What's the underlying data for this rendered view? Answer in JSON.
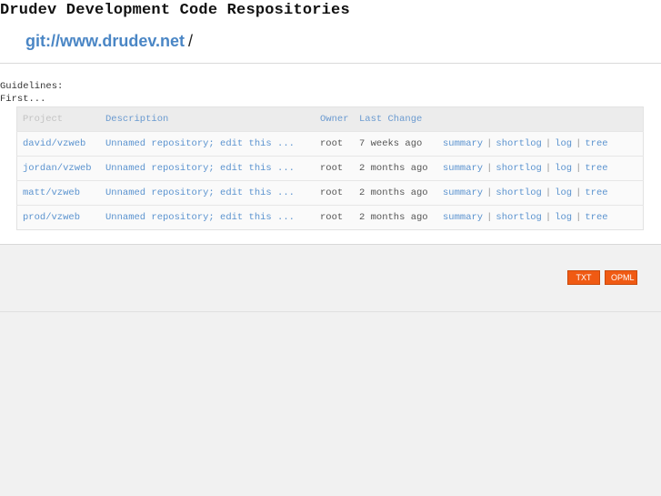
{
  "site": {
    "title": "Drudev Development Code Respositories",
    "url_link": "git://www.drudev.net",
    "url_suffix": "/"
  },
  "intro": {
    "guidelines_label": "Guidelines:",
    "first_line": "First..."
  },
  "table": {
    "headers": {
      "project": "Project",
      "description": "Description",
      "owner": "Owner",
      "last_change": "Last Change"
    },
    "rows": [
      {
        "project": "david/vzweb",
        "description": "Unnamed repository; edit this ...",
        "owner": "root",
        "last_change": "7 weeks ago",
        "actions": [
          "summary",
          "shortlog",
          "log",
          "tree"
        ]
      },
      {
        "project": "jordan/vzweb",
        "description": "Unnamed repository; edit this ...",
        "owner": "root",
        "last_change": "2 months ago",
        "actions": [
          "summary",
          "shortlog",
          "log",
          "tree"
        ]
      },
      {
        "project": "matt/vzweb",
        "description": "Unnamed repository; edit this ...",
        "owner": "root",
        "last_change": "2 months ago",
        "actions": [
          "summary",
          "shortlog",
          "log",
          "tree"
        ]
      },
      {
        "project": "prod/vzweb",
        "description": "Unnamed repository; edit this ...",
        "owner": "root",
        "last_change": "2 months ago",
        "actions": [
          "summary",
          "shortlog",
          "log",
          "tree"
        ]
      }
    ],
    "action_separator": "|"
  },
  "footer": {
    "txt_label": "TXT",
    "opml_label": "OPML",
    "badge_color": "#f05a13"
  },
  "colors": {
    "link": "#5b93cf",
    "background": "#f1f1f1",
    "panel": "#ffffff"
  }
}
